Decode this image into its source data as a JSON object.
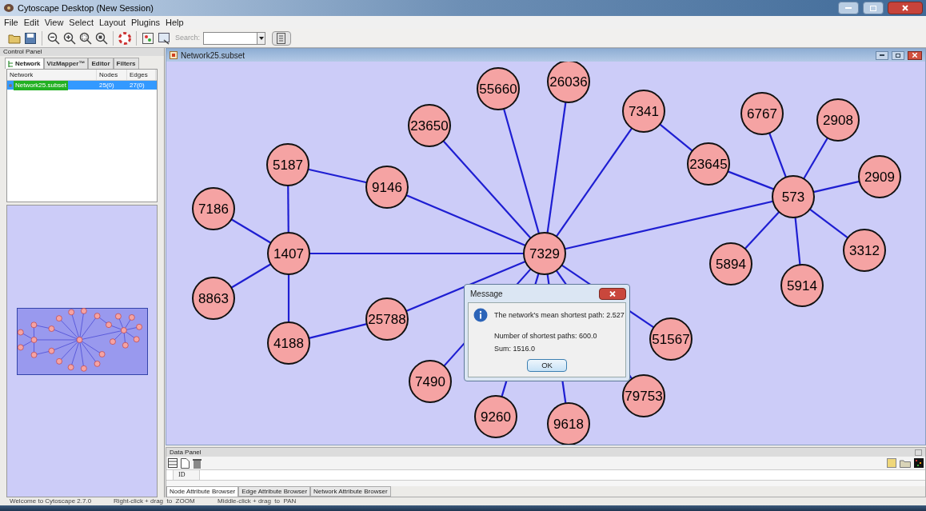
{
  "window": {
    "title": "Cytoscape Desktop (New Session)"
  },
  "menu": [
    "File",
    "Edit",
    "View",
    "Select",
    "Layout",
    "Plugins",
    "Help"
  ],
  "toolbar": {
    "search_label": "Search:"
  },
  "control_panel": {
    "title": "Control Panel",
    "tabs": [
      {
        "label": "Network",
        "selected": true
      },
      {
        "label": "VizMapper™",
        "selected": false
      },
      {
        "label": "Editor",
        "selected": false
      },
      {
        "label": "Filters",
        "selected": false
      }
    ],
    "columns": [
      "Network",
      "Nodes",
      "Edges"
    ],
    "rows": [
      {
        "network": "Network25.subset",
        "nodes": "25(0)",
        "edges": "27(0)",
        "selected": true
      }
    ]
  },
  "network_window": {
    "title": "Network25.subset",
    "nodes": [
      "55660",
      "26036",
      "23650",
      "7341",
      "6767",
      "2908",
      "5187",
      "9146",
      "23645",
      "2909",
      "7186",
      "573",
      "1407",
      "7329",
      "5894",
      "3312",
      "8863",
      "5914",
      "25788",
      "4188",
      "51567",
      "7490",
      "79753",
      "9260",
      "9618"
    ]
  },
  "message": {
    "title": "Message",
    "lines": [
      "The network's mean shortest path: 2.527",
      "Number of shortest paths: 600.0",
      "Sum: 1516.0"
    ],
    "button": "OK"
  },
  "data_panel": {
    "title": "Data Panel",
    "columns": [
      "ID"
    ],
    "tabs": [
      {
        "label": "Node Attribute Browser",
        "selected": true
      },
      {
        "label": "Edge Attribute Browser",
        "selected": false
      },
      {
        "label": "Network Attribute Browser",
        "selected": false
      }
    ]
  },
  "status_bar": [
    "Welcome to Cytoscape 2.7.0",
    "Right-click + drag  to  ZOOM",
    "Middle-click + drag  to  PAN"
  ]
}
